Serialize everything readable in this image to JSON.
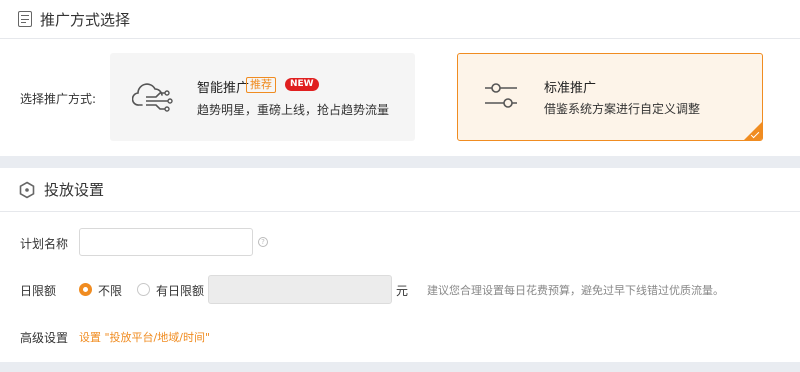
{
  "section1": {
    "title": "推广方式选择",
    "label": "选择推广方式:",
    "cards": [
      {
        "name": "智能推广",
        "badge": "推荐",
        "new_badge": "NEW",
        "desc": "趋势明星，重磅上线，抢占趋势流量",
        "selected": false
      },
      {
        "name": "标准推广",
        "desc": "借鉴系统方案进行自定义调整",
        "selected": true
      }
    ]
  },
  "section2": {
    "title": "投放设置",
    "plan_name": {
      "label": "计划名称",
      "value": "",
      "placeholder": "",
      "help": "?"
    },
    "daily_limit": {
      "label": "日限额",
      "options": [
        "不限",
        "有日限额"
      ],
      "selected": "不限",
      "amount": "",
      "unit": "元",
      "hint": "建议您合理设置每日花费预算，避免过早下线错过优质流量。"
    },
    "advanced": {
      "label": "高级设置",
      "link": "设置 \"投放平台/地域/时间\""
    }
  },
  "colors": {
    "accent": "#f08c21",
    "background": "#e9ecf1",
    "new_badge": "#e02020"
  }
}
